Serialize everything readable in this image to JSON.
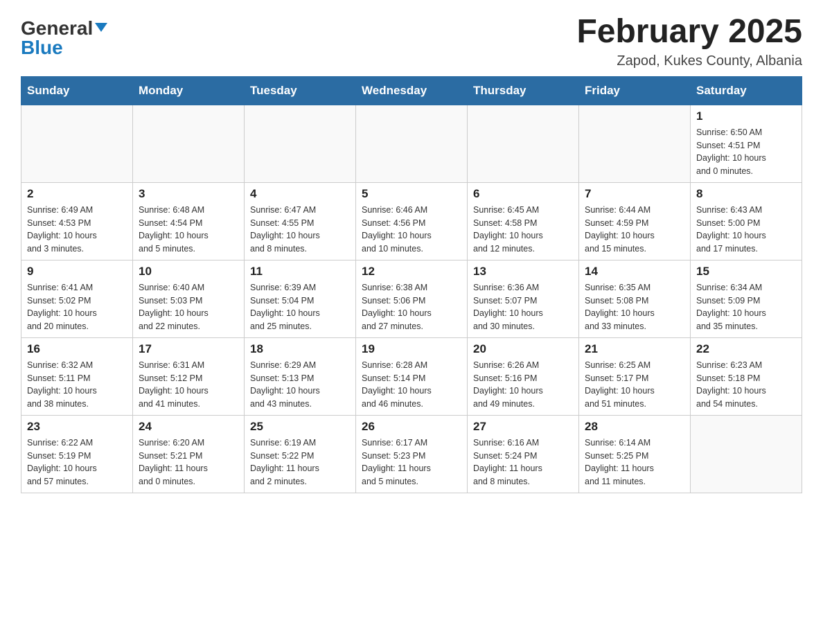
{
  "header": {
    "logo_general": "General",
    "logo_blue": "Blue",
    "month_title": "February 2025",
    "location": "Zapod, Kukes County, Albania"
  },
  "weekdays": [
    "Sunday",
    "Monday",
    "Tuesday",
    "Wednesday",
    "Thursday",
    "Friday",
    "Saturday"
  ],
  "weeks": [
    [
      {
        "day": "",
        "info": ""
      },
      {
        "day": "",
        "info": ""
      },
      {
        "day": "",
        "info": ""
      },
      {
        "day": "",
        "info": ""
      },
      {
        "day": "",
        "info": ""
      },
      {
        "day": "",
        "info": ""
      },
      {
        "day": "1",
        "info": "Sunrise: 6:50 AM\nSunset: 4:51 PM\nDaylight: 10 hours\nand 0 minutes."
      }
    ],
    [
      {
        "day": "2",
        "info": "Sunrise: 6:49 AM\nSunset: 4:53 PM\nDaylight: 10 hours\nand 3 minutes."
      },
      {
        "day": "3",
        "info": "Sunrise: 6:48 AM\nSunset: 4:54 PM\nDaylight: 10 hours\nand 5 minutes."
      },
      {
        "day": "4",
        "info": "Sunrise: 6:47 AM\nSunset: 4:55 PM\nDaylight: 10 hours\nand 8 minutes."
      },
      {
        "day": "5",
        "info": "Sunrise: 6:46 AM\nSunset: 4:56 PM\nDaylight: 10 hours\nand 10 minutes."
      },
      {
        "day": "6",
        "info": "Sunrise: 6:45 AM\nSunset: 4:58 PM\nDaylight: 10 hours\nand 12 minutes."
      },
      {
        "day": "7",
        "info": "Sunrise: 6:44 AM\nSunset: 4:59 PM\nDaylight: 10 hours\nand 15 minutes."
      },
      {
        "day": "8",
        "info": "Sunrise: 6:43 AM\nSunset: 5:00 PM\nDaylight: 10 hours\nand 17 minutes."
      }
    ],
    [
      {
        "day": "9",
        "info": "Sunrise: 6:41 AM\nSunset: 5:02 PM\nDaylight: 10 hours\nand 20 minutes."
      },
      {
        "day": "10",
        "info": "Sunrise: 6:40 AM\nSunset: 5:03 PM\nDaylight: 10 hours\nand 22 minutes."
      },
      {
        "day": "11",
        "info": "Sunrise: 6:39 AM\nSunset: 5:04 PM\nDaylight: 10 hours\nand 25 minutes."
      },
      {
        "day": "12",
        "info": "Sunrise: 6:38 AM\nSunset: 5:06 PM\nDaylight: 10 hours\nand 27 minutes."
      },
      {
        "day": "13",
        "info": "Sunrise: 6:36 AM\nSunset: 5:07 PM\nDaylight: 10 hours\nand 30 minutes."
      },
      {
        "day": "14",
        "info": "Sunrise: 6:35 AM\nSunset: 5:08 PM\nDaylight: 10 hours\nand 33 minutes."
      },
      {
        "day": "15",
        "info": "Sunrise: 6:34 AM\nSunset: 5:09 PM\nDaylight: 10 hours\nand 35 minutes."
      }
    ],
    [
      {
        "day": "16",
        "info": "Sunrise: 6:32 AM\nSunset: 5:11 PM\nDaylight: 10 hours\nand 38 minutes."
      },
      {
        "day": "17",
        "info": "Sunrise: 6:31 AM\nSunset: 5:12 PM\nDaylight: 10 hours\nand 41 minutes."
      },
      {
        "day": "18",
        "info": "Sunrise: 6:29 AM\nSunset: 5:13 PM\nDaylight: 10 hours\nand 43 minutes."
      },
      {
        "day": "19",
        "info": "Sunrise: 6:28 AM\nSunset: 5:14 PM\nDaylight: 10 hours\nand 46 minutes."
      },
      {
        "day": "20",
        "info": "Sunrise: 6:26 AM\nSunset: 5:16 PM\nDaylight: 10 hours\nand 49 minutes."
      },
      {
        "day": "21",
        "info": "Sunrise: 6:25 AM\nSunset: 5:17 PM\nDaylight: 10 hours\nand 51 minutes."
      },
      {
        "day": "22",
        "info": "Sunrise: 6:23 AM\nSunset: 5:18 PM\nDaylight: 10 hours\nand 54 minutes."
      }
    ],
    [
      {
        "day": "23",
        "info": "Sunrise: 6:22 AM\nSunset: 5:19 PM\nDaylight: 10 hours\nand 57 minutes."
      },
      {
        "day": "24",
        "info": "Sunrise: 6:20 AM\nSunset: 5:21 PM\nDaylight: 11 hours\nand 0 minutes."
      },
      {
        "day": "25",
        "info": "Sunrise: 6:19 AM\nSunset: 5:22 PM\nDaylight: 11 hours\nand 2 minutes."
      },
      {
        "day": "26",
        "info": "Sunrise: 6:17 AM\nSunset: 5:23 PM\nDaylight: 11 hours\nand 5 minutes."
      },
      {
        "day": "27",
        "info": "Sunrise: 6:16 AM\nSunset: 5:24 PM\nDaylight: 11 hours\nand 8 minutes."
      },
      {
        "day": "28",
        "info": "Sunrise: 6:14 AM\nSunset: 5:25 PM\nDaylight: 11 hours\nand 11 minutes."
      },
      {
        "day": "",
        "info": ""
      }
    ]
  ]
}
